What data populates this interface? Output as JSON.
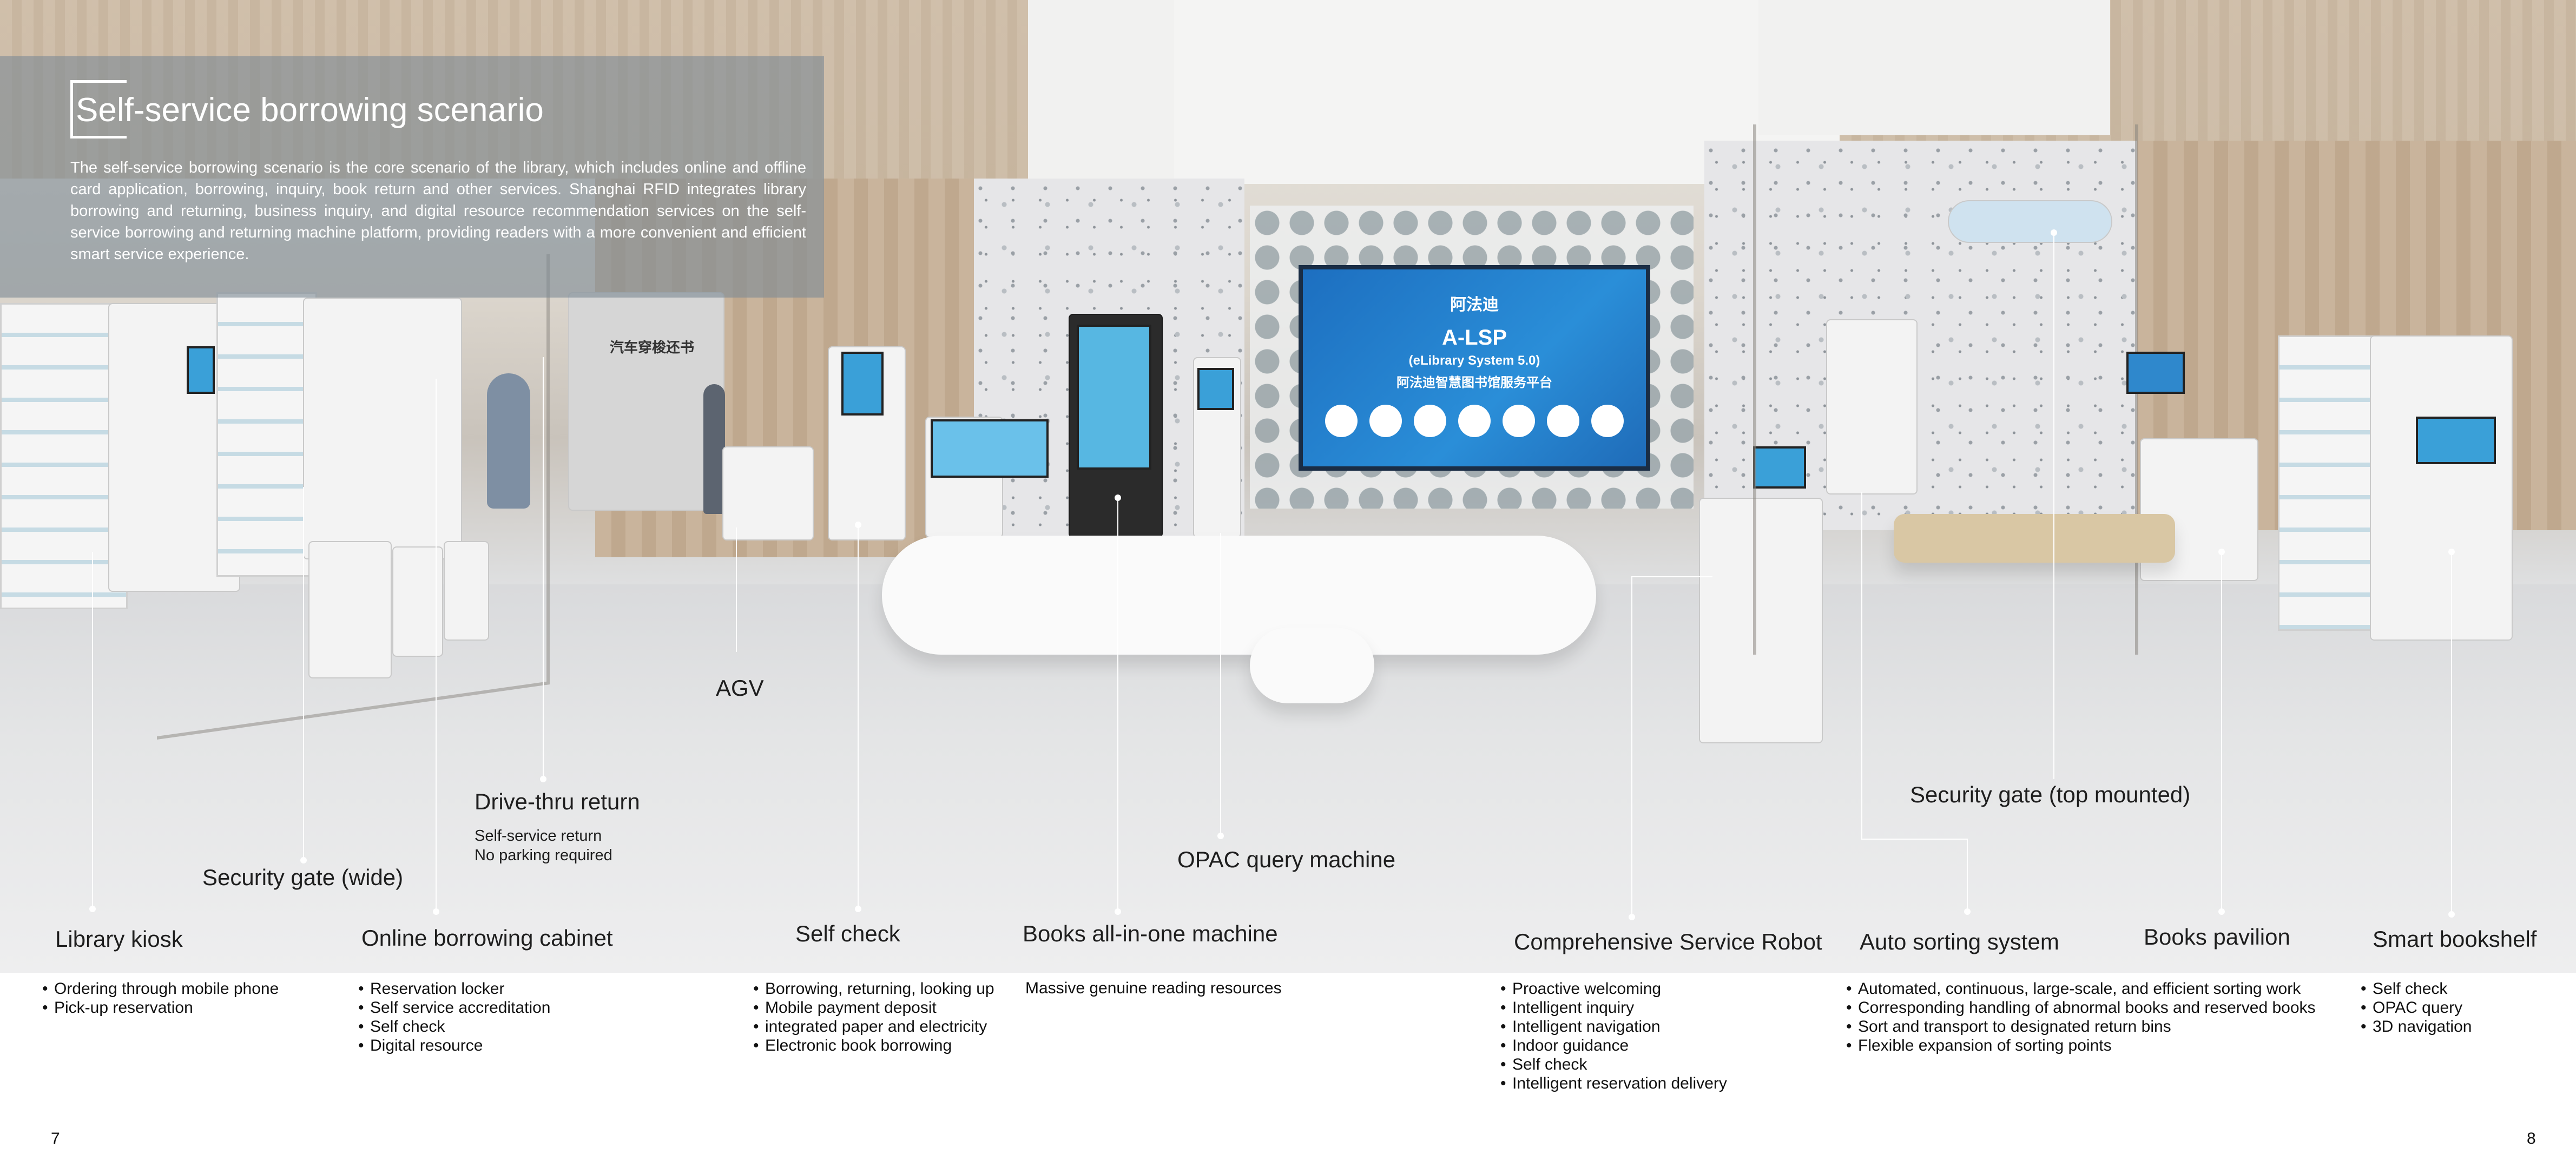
{
  "header": {
    "title": "Self-service borrowing scenario",
    "intro": "The self-service borrowing scenario is the core scenario of the library, which includes online and offline card application, borrowing, inquiry, book return and other services. Shanghai RFID integrates library borrowing and returning, business inquiry, and digital resource recommendation services on the self-service borrowing and returning machine platform, providing readers with a more convenient and efficient smart service experience."
  },
  "scene": {
    "screen_brand": "阿法迪",
    "screen_title": "A-LSP",
    "screen_subtitle": "(eLibrary System 5.0)",
    "screen_cn": "阿法迪智慧图书馆服务平台",
    "drive_thru_sign": "汽车穿梭还书"
  },
  "labels": {
    "library_kiosk": "Library kiosk",
    "security_gate_wide": "Security gate (wide)",
    "online_borrowing_cabinet": "Online borrowing cabinet",
    "drive_thru_return": "Drive-thru return",
    "drive_thru_notes": [
      "Self-service return",
      "No parking required"
    ],
    "agv": "AGV",
    "self_check": "Self check",
    "books_all_in_one": "Books all-in-one machine",
    "opac": "OPAC query machine",
    "service_robot": "Comprehensive Service Robot",
    "security_gate_top": "Security gate (top mounted)",
    "auto_sorting": "Auto sorting system",
    "books_pavilion": "Books pavilion",
    "smart_bookshelf": "Smart bookshelf"
  },
  "features": {
    "library_kiosk": [
      "Ordering through mobile phone",
      "Pick-up reservation"
    ],
    "online_borrowing_cabinet": [
      "Reservation locker",
      "Self service accreditation",
      "Self check",
      "Digital resource"
    ],
    "self_check": [
      "Borrowing, returning, looking up",
      "Mobile payment deposit",
      "integrated paper and electricity",
      "Electronic book borrowing"
    ],
    "books_all_in_one": "Massive genuine reading resources",
    "service_robot": [
      "Proactive welcoming",
      "Intelligent inquiry",
      "Intelligent navigation",
      "Indoor guidance",
      "Self check",
      "Intelligent reservation delivery"
    ],
    "auto_sorting": [
      "Automated, continuous, large-scale, and efficient sorting work",
      "Corresponding handling of abnormal books and reserved books",
      "Sort and transport to designated return bins",
      "Flexible expansion of sorting points"
    ],
    "smart_bookshelf": [
      "Self check",
      "OPAC query",
      "3D navigation"
    ]
  },
  "pages": {
    "left": "7",
    "right": "8"
  }
}
